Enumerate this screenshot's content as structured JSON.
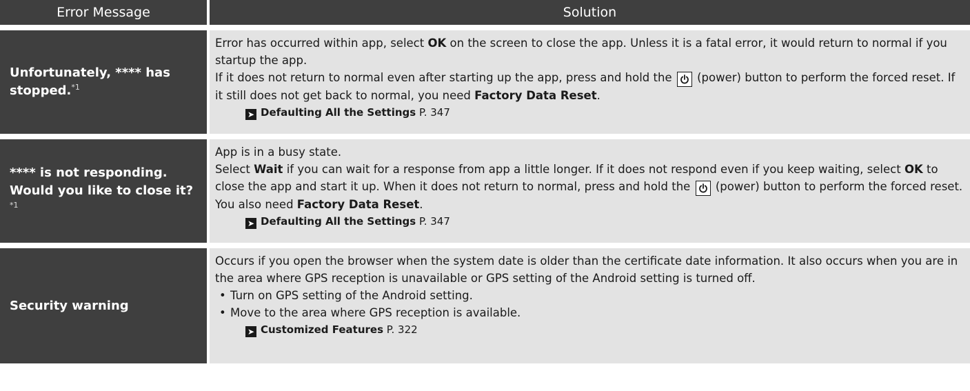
{
  "header": {
    "col_message": "Error Message",
    "col_solution": "Solution"
  },
  "rows": [
    {
      "message": "Unfortunately, **** has stopped.",
      "footnote": "*1",
      "solution": {
        "l1_a": "Error has occurred within app, select ",
        "l1_b": "OK",
        "l1_c": " on the screen to close the app. Unless it is a fatal error, it would return to normal if you startup the app.",
        "l2_a": "If it does not return to normal even after starting up the app, press and hold the ",
        "l2_b": " (power) button to perform the forced reset. If it still does not get back to normal, you need ",
        "l2_c": "Factory Data Reset",
        "l2_d": ".",
        "ref_title": "Defaulting All the Settings",
        "ref_page": " P. 347"
      }
    },
    {
      "message": "**** is not responding. Would you like to close it?",
      "footnote": "*1",
      "solution": {
        "l1": "App is in a busy state.",
        "l2_a": "Select ",
        "l2_b": "Wait",
        "l2_c": " if you can wait for a response from app a little longer. If it does not respond even if you keep waiting, select ",
        "l2_d": "OK",
        "l2_e": " to close the app and start it up. When it does not return to normal, press and hold the ",
        "l2_f": " (power) button to perform the forced reset. You also need ",
        "l2_g": "Factory Data Reset",
        "l2_h": ".",
        "ref_title": "Defaulting All the Settings",
        "ref_page": " P. 347"
      }
    },
    {
      "message": "Security warning",
      "solution": {
        "l1": "Occurs if you open the browser when the system date is older than the certificate date information. It also occurs when you are in the area where GPS reception is unavailable or GPS setting of the Android setting is turned off.",
        "bullet1": "Turn on GPS setting of the Android setting.",
        "bullet2": "Move to the area where GPS reception is available.",
        "ref_title": "Customized Features",
        "ref_page": " P. 322"
      }
    }
  ],
  "icons": {
    "power": "power-icon",
    "ref_arrow": "reference-arrow-icon",
    "bullet": "bullet-icon"
  },
  "colors": {
    "header_bg": "#3f3f3f",
    "solution_bg": "#e3e3e3"
  }
}
